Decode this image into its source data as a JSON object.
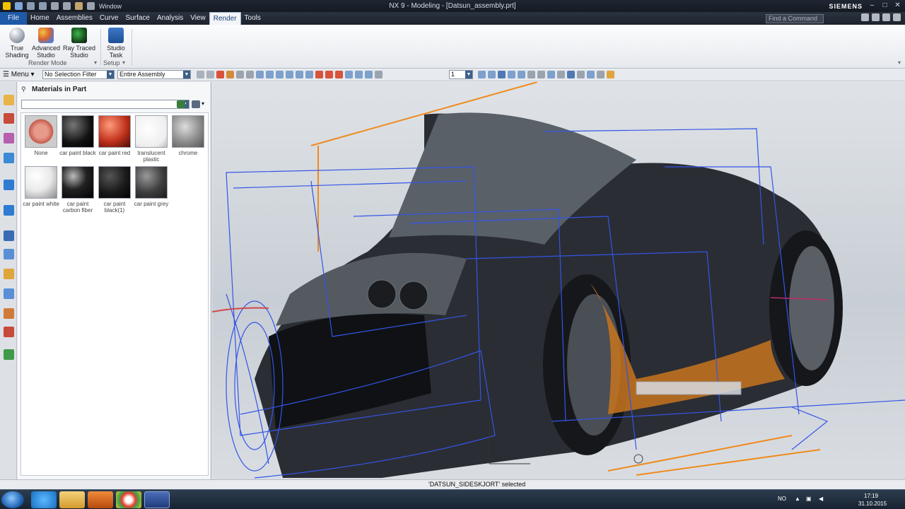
{
  "window": {
    "title": "NX 9 - Modeling - [Datsun_assembly.prt]",
    "brand": "SIEMENS",
    "qat_window_label": "Window"
  },
  "menubar": {
    "tabs": [
      "File",
      "Home",
      "Assemblies",
      "Curve",
      "Surface",
      "Analysis",
      "View",
      "Render",
      "Tools"
    ],
    "active_tab": "Render",
    "find_placeholder": "Find a Command"
  },
  "ribbon": {
    "buttons": [
      {
        "label1": "True",
        "label2": "Shading"
      },
      {
        "label1": "Advanced",
        "label2": "Studio"
      },
      {
        "label1": "Ray Traced",
        "label2": "Studio"
      },
      {
        "label1": "Studio",
        "label2": "Task"
      }
    ],
    "groups": [
      "Render Mode",
      "Setup"
    ]
  },
  "toolbar": {
    "menu_label": "Menu",
    "selection_filter": "No Selection Filter",
    "scope": "Entire Assembly",
    "layer": "1"
  },
  "navigator": {
    "title": "Materials in Part",
    "materials": [
      {
        "name": "None"
      },
      {
        "name": "car paint black"
      },
      {
        "name": "car paint red"
      },
      {
        "name": "translucent plastic"
      },
      {
        "name": "chrome"
      },
      {
        "name": "car paint white"
      },
      {
        "name": "car paint carbon fiber"
      },
      {
        "name": "car paint black(1)"
      },
      {
        "name": "car paint grey"
      }
    ]
  },
  "status": {
    "message": "'DATSUN_SIDESKJORT' selected"
  },
  "taskbar": {
    "lang": "NO",
    "time": "17:19",
    "date": "31.10.2015"
  },
  "colors": {
    "accent": "#1e5aa8",
    "wireframe": "#3355e6",
    "highlight": "#f08a1c"
  }
}
